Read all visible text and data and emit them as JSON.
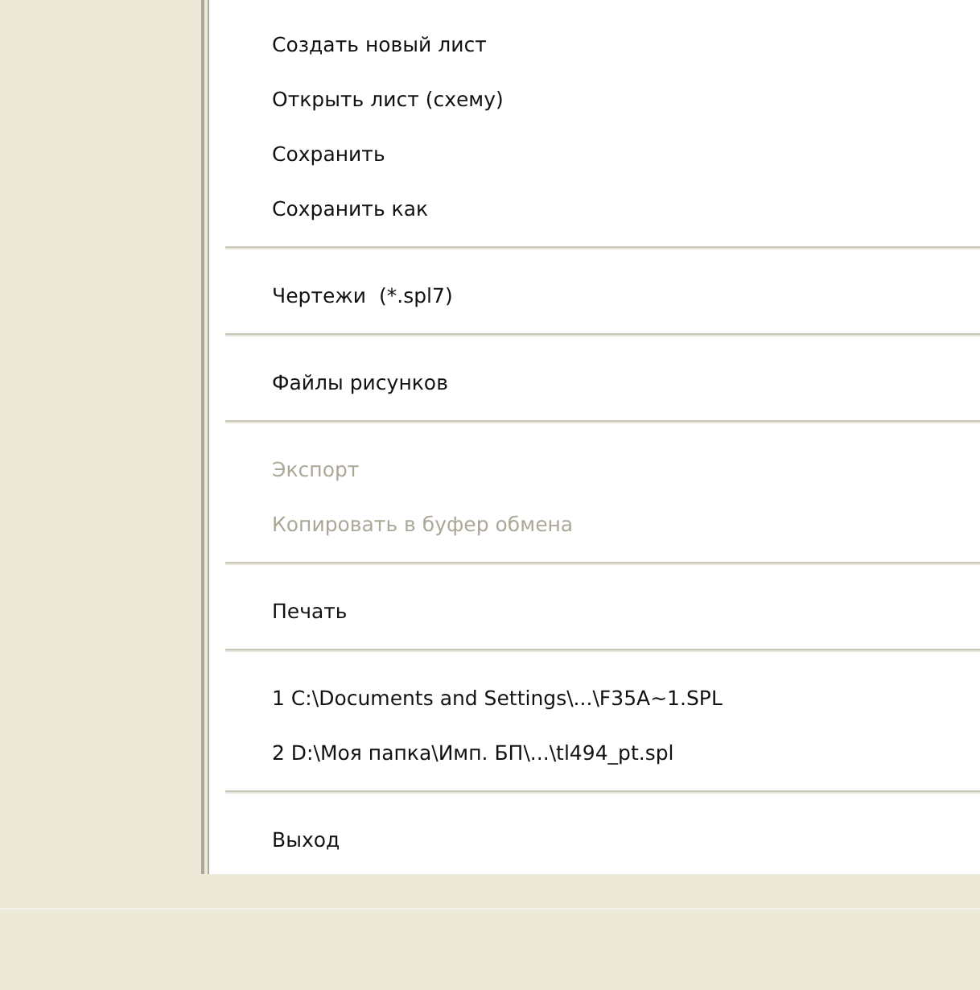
{
  "menu": {
    "items": [
      {
        "kind": "item",
        "label": "Создать новый лист",
        "disabled": false
      },
      {
        "kind": "item",
        "label": "Открыть лист (схему)",
        "disabled": false
      },
      {
        "kind": "item",
        "label": "Сохранить",
        "disabled": false
      },
      {
        "kind": "item",
        "label": "Сохранить как",
        "disabled": false
      },
      {
        "kind": "separator"
      },
      {
        "kind": "item",
        "label": "Чертежи  (*.spl7)",
        "disabled": false
      },
      {
        "kind": "separator"
      },
      {
        "kind": "item",
        "label": "Файлы рисунков",
        "disabled": false
      },
      {
        "kind": "separator"
      },
      {
        "kind": "item",
        "label": "Экспорт",
        "disabled": true
      },
      {
        "kind": "item",
        "label": "Копировать в буфер обмена",
        "disabled": true
      },
      {
        "kind": "separator"
      },
      {
        "kind": "item",
        "label": "Печать",
        "disabled": false
      },
      {
        "kind": "separator"
      },
      {
        "kind": "item",
        "label": "1 C:\\Documents and Settings\\...\\F35A~1.SPL",
        "disabled": false
      },
      {
        "kind": "item",
        "label": "2 D:\\Моя папка\\Имп. БП\\...\\tl494_pt.spl",
        "disabled": false
      },
      {
        "kind": "separator"
      },
      {
        "kind": "item",
        "label": "Выход",
        "disabled": false
      }
    ]
  }
}
